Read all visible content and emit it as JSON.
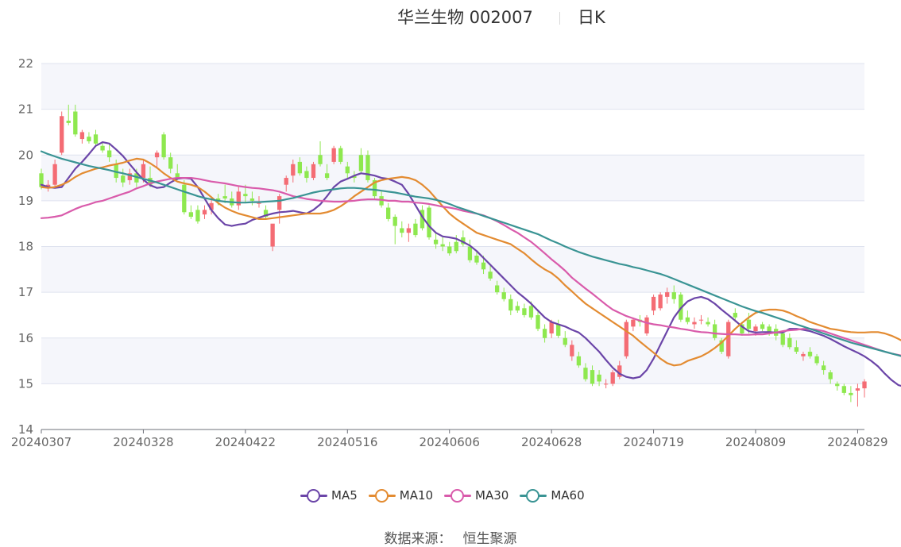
{
  "title": {
    "main": "华兰生物 002007",
    "sub": "日K"
  },
  "source": {
    "label": "数据来源：",
    "value": "恒生聚源"
  },
  "colors": {
    "up": "#f46c74",
    "down": "#8ee84f",
    "ma5": "#6b45a8",
    "ma10": "#e38b31",
    "ma30": "#d95bab",
    "ma60": "#3a9494",
    "band": "#f5f6fb",
    "grid": "#dfe3ef"
  },
  "chart_data": {
    "type": "candlestick",
    "ylim": [
      14,
      22
    ],
    "yticks": [
      "14",
      "15",
      "16",
      "17",
      "18",
      "19",
      "20",
      "21",
      "22"
    ],
    "x_tick_labels": [
      "20240307",
      "20240328",
      "20240422",
      "20240516",
      "20240606",
      "20240628",
      "20240719",
      "20240809",
      "20240829"
    ],
    "x_tick_index": [
      0,
      15,
      30,
      45,
      60,
      75,
      90,
      105,
      120
    ],
    "grid": true,
    "alternating_bands": true,
    "legend_position": "bottom-center",
    "candles_ohlc": [
      [
        19.6,
        19.7,
        19.25,
        19.3
      ],
      [
        19.3,
        19.45,
        19.2,
        19.35
      ],
      [
        19.35,
        19.9,
        19.3,
        19.8
      ],
      [
        20.05,
        20.95,
        20.0,
        20.85
      ],
      [
        20.75,
        21.1,
        20.65,
        20.7
      ],
      [
        20.95,
        21.1,
        20.4,
        20.45
      ],
      [
        20.35,
        20.55,
        20.25,
        20.5
      ],
      [
        20.4,
        20.5,
        20.25,
        20.3
      ],
      [
        20.45,
        20.55,
        20.2,
        20.25
      ],
      [
        20.2,
        20.3,
        20.05,
        20.1
      ],
      [
        20.1,
        20.25,
        19.85,
        19.95
      ],
      [
        19.8,
        19.9,
        19.4,
        19.5
      ],
      [
        19.55,
        19.7,
        19.3,
        19.4
      ],
      [
        19.45,
        19.7,
        19.35,
        19.6
      ],
      [
        19.6,
        19.7,
        19.3,
        19.4
      ],
      [
        19.5,
        19.9,
        19.4,
        19.8
      ],
      [
        19.5,
        19.75,
        19.3,
        19.35
      ],
      [
        19.95,
        20.1,
        19.7,
        20.05
      ],
      [
        20.45,
        20.5,
        19.9,
        19.95
      ],
      [
        19.95,
        20.05,
        19.6,
        19.7
      ],
      [
        19.6,
        19.8,
        19.45,
        19.5
      ],
      [
        19.35,
        19.45,
        18.7,
        18.75
      ],
      [
        18.75,
        18.9,
        18.6,
        18.65
      ],
      [
        18.8,
        18.9,
        18.5,
        18.55
      ],
      [
        18.7,
        18.9,
        18.6,
        18.8
      ],
      [
        18.8,
        19.05,
        18.7,
        18.95
      ],
      [
        19.05,
        19.15,
        18.9,
        19.0
      ],
      [
        19.1,
        19.35,
        18.95,
        19.05
      ],
      [
        19.05,
        19.2,
        18.85,
        18.9
      ],
      [
        18.9,
        19.3,
        18.8,
        19.2
      ],
      [
        19.15,
        19.35,
        18.95,
        19.1
      ],
      [
        19.05,
        19.2,
        18.9,
        19.0
      ],
      [
        18.95,
        19.1,
        18.85,
        18.95
      ],
      [
        18.8,
        18.9,
        18.6,
        18.65
      ],
      [
        18.0,
        18.45,
        17.9,
        18.5
      ],
      [
        18.8,
        19.15,
        18.5,
        19.1
      ],
      [
        19.35,
        19.55,
        19.2,
        19.5
      ],
      [
        19.55,
        19.9,
        19.4,
        19.8
      ],
      [
        19.85,
        19.95,
        19.55,
        19.6
      ],
      [
        19.65,
        19.75,
        19.4,
        19.5
      ],
      [
        19.5,
        19.85,
        19.45,
        19.8
      ],
      [
        20.0,
        20.3,
        19.75,
        19.8
      ],
      [
        19.6,
        19.8,
        19.45,
        19.5
      ],
      [
        19.85,
        20.2,
        19.8,
        20.15
      ],
      [
        20.15,
        20.2,
        19.8,
        19.85
      ],
      [
        19.75,
        19.85,
        19.5,
        19.6
      ],
      [
        19.55,
        19.65,
        19.4,
        19.5
      ],
      [
        20.0,
        20.15,
        19.6,
        19.65
      ],
      [
        20.0,
        20.1,
        19.4,
        19.45
      ],
      [
        19.45,
        19.5,
        19.05,
        19.1
      ],
      [
        19.1,
        19.2,
        18.85,
        18.9
      ],
      [
        18.85,
        18.95,
        18.55,
        18.6
      ],
      [
        18.65,
        18.7,
        18.05,
        18.45
      ],
      [
        18.4,
        18.55,
        18.2,
        18.3
      ],
      [
        18.3,
        18.5,
        18.1,
        18.4
      ],
      [
        18.5,
        18.6,
        18.2,
        18.25
      ],
      [
        18.8,
        18.9,
        18.35,
        18.4
      ],
      [
        18.85,
        18.9,
        18.15,
        18.2
      ],
      [
        18.15,
        18.3,
        17.95,
        18.05
      ],
      [
        18.05,
        18.2,
        17.9,
        18.0
      ],
      [
        18.0,
        18.1,
        17.8,
        17.85
      ],
      [
        18.1,
        18.25,
        17.85,
        17.9
      ],
      [
        18.2,
        18.35,
        18.0,
        18.05
      ],
      [
        18.0,
        18.15,
        17.65,
        17.7
      ],
      [
        17.8,
        17.9,
        17.6,
        17.65
      ],
      [
        17.65,
        17.8,
        17.4,
        17.5
      ],
      [
        17.45,
        17.6,
        17.25,
        17.3
      ],
      [
        17.15,
        17.25,
        16.95,
        17.0
      ],
      [
        17.0,
        17.1,
        16.8,
        16.85
      ],
      [
        16.85,
        16.95,
        16.5,
        16.6
      ],
      [
        16.7,
        16.8,
        16.55,
        16.6
      ],
      [
        16.65,
        16.75,
        16.45,
        16.5
      ],
      [
        16.7,
        16.8,
        16.4,
        16.45
      ],
      [
        16.5,
        16.6,
        16.15,
        16.2
      ],
      [
        16.2,
        16.3,
        15.9,
        16.0
      ],
      [
        16.1,
        16.4,
        16.0,
        16.35
      ],
      [
        16.3,
        16.4,
        16.0,
        16.05
      ],
      [
        16.0,
        16.15,
        15.8,
        15.85
      ],
      [
        15.6,
        15.95,
        15.5,
        15.85
      ],
      [
        15.6,
        15.7,
        15.35,
        15.4
      ],
      [
        15.35,
        15.45,
        15.05,
        15.1
      ],
      [
        15.3,
        15.4,
        14.95,
        15.0
      ],
      [
        15.2,
        15.3,
        14.95,
        15.05
      ],
      [
        15.0,
        15.1,
        14.9,
        15.0
      ],
      [
        15.0,
        15.3,
        14.95,
        15.25
      ],
      [
        15.15,
        15.5,
        15.1,
        15.4
      ],
      [
        15.6,
        16.4,
        15.55,
        16.35
      ],
      [
        16.25,
        16.45,
        16.15,
        16.4
      ],
      [
        16.4,
        16.5,
        16.25,
        16.35
      ],
      [
        16.1,
        16.5,
        16.05,
        16.45
      ],
      [
        16.6,
        16.95,
        16.5,
        16.9
      ],
      [
        16.65,
        17.0,
        16.6,
        16.95
      ],
      [
        16.9,
        17.1,
        16.75,
        17.0
      ],
      [
        17.0,
        17.15,
        16.75,
        16.85
      ],
      [
        16.95,
        17.0,
        16.35,
        16.4
      ],
      [
        16.45,
        16.6,
        16.3,
        16.35
      ],
      [
        16.3,
        16.45,
        16.2,
        16.35
      ],
      [
        16.4,
        16.5,
        16.3,
        16.4
      ],
      [
        16.35,
        16.45,
        16.25,
        16.3
      ],
      [
        16.3,
        16.4,
        15.95,
        16.0
      ],
      [
        15.95,
        16.0,
        15.65,
        15.7
      ],
      [
        15.6,
        16.4,
        15.55,
        16.35
      ],
      [
        16.55,
        16.65,
        16.35,
        16.45
      ],
      [
        16.3,
        16.35,
        16.05,
        16.1
      ],
      [
        16.4,
        16.55,
        16.1,
        16.2
      ],
      [
        16.15,
        16.3,
        16.05,
        16.25
      ],
      [
        16.3,
        16.35,
        16.15,
        16.2
      ],
      [
        16.25,
        16.3,
        16.05,
        16.1
      ],
      [
        16.2,
        16.3,
        15.95,
        16.05
      ],
      [
        16.1,
        16.15,
        15.8,
        15.85
      ],
      [
        16.0,
        16.1,
        15.75,
        15.8
      ],
      [
        15.8,
        15.95,
        15.65,
        15.7
      ],
      [
        15.6,
        15.7,
        15.5,
        15.65
      ],
      [
        15.7,
        15.8,
        15.55,
        15.6
      ],
      [
        15.6,
        15.65,
        15.4,
        15.45
      ],
      [
        15.4,
        15.5,
        15.2,
        15.3
      ],
      [
        15.25,
        15.3,
        15.0,
        15.1
      ],
      [
        15.0,
        15.05,
        14.85,
        14.95
      ],
      [
        14.95,
        15.0,
        14.75,
        14.8
      ],
      [
        14.8,
        14.95,
        14.6,
        14.75
      ],
      [
        14.85,
        15.0,
        14.5,
        14.9
      ],
      [
        14.9,
        15.1,
        14.7,
        15.05
      ]
    ],
    "series": [
      {
        "name": "MA5",
        "values": [
          19.35,
          19.3,
          19.28,
          19.3,
          19.5,
          19.7,
          19.85,
          20.02,
          20.2,
          20.28,
          20.25,
          20.12,
          19.98,
          19.8,
          19.62,
          19.46,
          19.34,
          19.28,
          19.3,
          19.4,
          19.48,
          19.5,
          19.48,
          19.3,
          19.05,
          18.8,
          18.62,
          18.48,
          18.45,
          18.48,
          18.5,
          18.58,
          18.63,
          18.68,
          18.72,
          18.75,
          18.76,
          18.78,
          18.75,
          18.72,
          18.8,
          18.92,
          19.1,
          19.3,
          19.42,
          19.48,
          19.55,
          19.6,
          19.58,
          19.55,
          19.5,
          19.48,
          19.42,
          19.35,
          19.15,
          18.9,
          18.65,
          18.45,
          18.3,
          18.22,
          18.2,
          18.17,
          18.1,
          18.02,
          17.9,
          17.75,
          17.6,
          17.45,
          17.3,
          17.15,
          17.0,
          16.88,
          16.75,
          16.6,
          16.45,
          16.35,
          16.3,
          16.25,
          16.18,
          16.12,
          16.0,
          15.85,
          15.7,
          15.52,
          15.35,
          15.22,
          15.15,
          15.12,
          15.15,
          15.3,
          15.55,
          15.85,
          16.15,
          16.45,
          16.65,
          16.8,
          16.87,
          16.9,
          16.85,
          16.75,
          16.62,
          16.5,
          16.38,
          16.25,
          16.15,
          16.12,
          16.13,
          16.13,
          16.12,
          16.12,
          16.2,
          16.2,
          16.18,
          16.15,
          16.1,
          16.05,
          15.98,
          15.9,
          15.82,
          15.75,
          15.68,
          15.6,
          15.5,
          15.38,
          15.22,
          15.08,
          14.97,
          14.93,
          14.95
        ]
      },
      {
        "name": "MA10",
        "values": [
          19.3,
          19.28,
          19.3,
          19.35,
          19.42,
          19.52,
          19.6,
          19.65,
          19.7,
          19.73,
          19.77,
          19.8,
          19.83,
          19.88,
          19.92,
          19.9,
          19.82,
          19.72,
          19.6,
          19.5,
          19.42,
          19.38,
          19.35,
          19.3,
          19.2,
          19.08,
          18.95,
          18.85,
          18.78,
          18.72,
          18.68,
          18.64,
          18.6,
          18.6,
          18.62,
          18.64,
          18.66,
          18.68,
          18.7,
          18.72,
          18.72,
          18.72,
          18.75,
          18.8,
          18.88,
          18.98,
          19.1,
          19.2,
          19.3,
          19.4,
          19.45,
          19.48,
          19.5,
          19.52,
          19.5,
          19.45,
          19.35,
          19.22,
          19.05,
          18.88,
          18.72,
          18.6,
          18.5,
          18.4,
          18.3,
          18.25,
          18.2,
          18.15,
          18.1,
          18.05,
          17.95,
          17.85,
          17.72,
          17.6,
          17.5,
          17.42,
          17.3,
          17.15,
          17.02,
          16.88,
          16.75,
          16.65,
          16.55,
          16.45,
          16.35,
          16.25,
          16.15,
          16.05,
          15.92,
          15.8,
          15.68,
          15.55,
          15.45,
          15.4,
          15.42,
          15.5,
          15.55,
          15.6,
          15.68,
          15.78,
          15.9,
          16.05,
          16.2,
          16.33,
          16.45,
          16.55,
          16.6,
          16.62,
          16.62,
          16.6,
          16.55,
          16.48,
          16.42,
          16.35,
          16.3,
          16.25,
          16.2,
          16.18,
          16.15,
          16.13,
          16.12,
          16.12,
          16.13,
          16.13,
          16.1,
          16.05,
          15.98,
          15.9,
          15.82,
          15.75,
          15.68,
          15.62,
          15.55,
          15.45,
          15.35,
          15.25,
          15.15
        ]
      },
      {
        "name": "MA30",
        "values": [
          18.62,
          18.63,
          18.65,
          18.68,
          18.75,
          18.82,
          18.88,
          18.92,
          18.97,
          19.0,
          19.05,
          19.1,
          19.15,
          19.2,
          19.27,
          19.32,
          19.38,
          19.42,
          19.45,
          19.48,
          19.5,
          19.5,
          19.5,
          19.48,
          19.45,
          19.42,
          19.4,
          19.38,
          19.35,
          19.32,
          19.3,
          19.28,
          19.27,
          19.25,
          19.23,
          19.2,
          19.15,
          19.1,
          19.07,
          19.04,
          19.02,
          19.0,
          18.99,
          18.98,
          18.98,
          18.99,
          19.0,
          19.02,
          19.03,
          19.03,
          19.02,
          19.0,
          19.0,
          18.98,
          18.98,
          18.96,
          18.95,
          18.93,
          18.9,
          18.87,
          18.85,
          18.82,
          18.78,
          18.75,
          18.72,
          18.68,
          18.62,
          18.55,
          18.47,
          18.38,
          18.3,
          18.2,
          18.1,
          17.98,
          17.85,
          17.72,
          17.6,
          17.47,
          17.32,
          17.2,
          17.08,
          16.97,
          16.85,
          16.73,
          16.62,
          16.55,
          16.48,
          16.43,
          16.38,
          16.33,
          16.3,
          16.28,
          16.25,
          16.23,
          16.2,
          16.18,
          16.15,
          16.13,
          16.12,
          16.1,
          16.09,
          16.08,
          16.08,
          16.07,
          16.07,
          16.08,
          16.08,
          16.1,
          16.12,
          16.15,
          16.17,
          16.18,
          16.2,
          16.2,
          16.18,
          16.15,
          16.1,
          16.05,
          16.0,
          15.95,
          15.9,
          15.85,
          15.8,
          15.75,
          15.7,
          15.66,
          15.63,
          15.6,
          15.58,
          15.55,
          15.52,
          15.5,
          15.48
        ]
      },
      {
        "name": "MA60",
        "values": [
          20.08,
          20.02,
          19.97,
          19.92,
          19.88,
          19.84,
          19.8,
          19.76,
          19.73,
          19.7,
          19.67,
          19.63,
          19.6,
          19.56,
          19.52,
          19.48,
          19.44,
          19.4,
          19.35,
          19.3,
          19.25,
          19.2,
          19.15,
          19.1,
          19.06,
          19.03,
          19.0,
          18.98,
          18.97,
          18.96,
          18.96,
          18.97,
          18.97,
          18.98,
          18.99,
          19.0,
          19.03,
          19.06,
          19.1,
          19.14,
          19.18,
          19.21,
          19.23,
          19.25,
          19.27,
          19.28,
          19.28,
          19.27,
          19.25,
          19.24,
          19.22,
          19.2,
          19.18,
          19.15,
          19.12,
          19.09,
          19.07,
          19.05,
          19.02,
          18.98,
          18.93,
          18.87,
          18.82,
          18.77,
          18.72,
          18.67,
          18.62,
          18.57,
          18.52,
          18.47,
          18.42,
          18.37,
          18.32,
          18.27,
          18.2,
          18.13,
          18.07,
          18.0,
          17.94,
          17.88,
          17.83,
          17.78,
          17.74,
          17.7,
          17.66,
          17.62,
          17.59,
          17.55,
          17.52,
          17.48,
          17.44,
          17.4,
          17.35,
          17.29,
          17.23,
          17.17,
          17.11,
          17.05,
          16.99,
          16.93,
          16.87,
          16.81,
          16.75,
          16.69,
          16.64,
          16.59,
          16.55,
          16.5,
          16.45,
          16.4,
          16.35,
          16.3,
          16.25,
          16.2,
          16.15,
          16.1,
          16.05,
          16.0,
          15.95,
          15.9,
          15.86,
          15.82,
          15.78,
          15.74,
          15.7,
          15.66,
          15.62,
          15.58,
          15.54,
          15.5,
          15.46
        ]
      }
    ]
  }
}
